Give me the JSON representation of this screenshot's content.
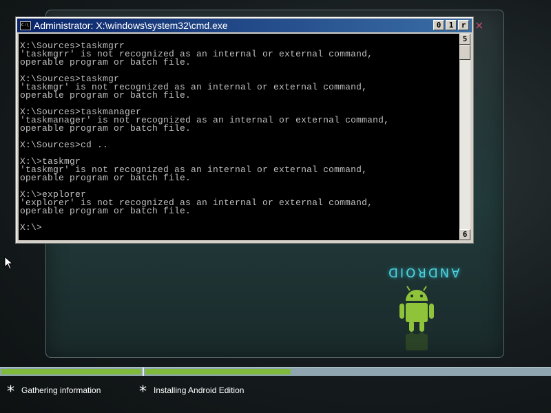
{
  "cmd_window": {
    "title": "Administrator: X:\\windows\\system32\\cmd.exe",
    "controls": {
      "minimize": "0",
      "maximize": "1",
      "close": "r"
    },
    "scroll_up_label": "5",
    "scroll_down_label": "6",
    "lines": [
      "",
      "X:\\Sources>taskmgrr",
      "'taskmgrr' is not recognized as an internal or external command,",
      "operable program or batch file.",
      "",
      "X:\\Sources>taskmgr",
      "'taskmgr' is not recognized as an internal or external command,",
      "operable program or batch file.",
      "",
      "X:\\Sources>taskmanager",
      "'taskmanager' is not recognized as an internal or external command,",
      "operable program or batch file.",
      "",
      "X:\\Sources>cd ..",
      "",
      "X:\\>taskmgr",
      "'taskmgr' is not recognized as an internal or external command,",
      "operable program or batch file.",
      "",
      "X:\\>explorer",
      "'explorer' is not recognized as an internal or external command,",
      "operable program or batch file.",
      "",
      "X:\\>"
    ]
  },
  "background": {
    "close_glyph": "×",
    "wordmark": "ANDROID"
  },
  "progress": {
    "segment_1_fill": 1.0,
    "segment_2_fill": 0.36,
    "color_fill": "#7fba3a",
    "color_track": "#8fa6b0"
  },
  "steps": [
    {
      "icon": "asterisk-icon",
      "symbol": "*",
      "label": "Gathering information"
    },
    {
      "icon": "asterisk-icon",
      "symbol": "*",
      "label": "Installing Android Edition"
    }
  ]
}
